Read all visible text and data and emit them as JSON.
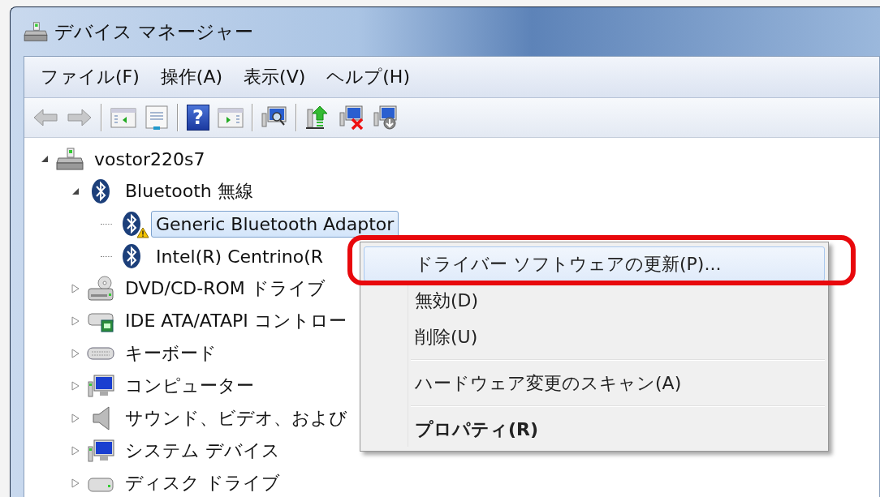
{
  "window": {
    "title": "デバイス マネージャー"
  },
  "menu_bar": [
    "ファイル(F)",
    "操作(A)",
    "表示(V)",
    "ヘルプ(H)"
  ],
  "toolbar": [
    {
      "kind": "back",
      "disabled": true
    },
    {
      "kind": "forward",
      "disabled": true
    },
    {
      "kind": "separator"
    },
    {
      "kind": "tree-pane",
      "disabled": false
    },
    {
      "kind": "properties",
      "disabled": false
    },
    {
      "kind": "separator"
    },
    {
      "kind": "help",
      "disabled": false,
      "glyph": "?"
    },
    {
      "kind": "action-pane",
      "disabled": false
    },
    {
      "kind": "separator"
    },
    {
      "kind": "scan",
      "disabled": false
    },
    {
      "kind": "separator"
    },
    {
      "kind": "update",
      "disabled": false
    },
    {
      "kind": "disable",
      "disabled": false
    },
    {
      "kind": "uninstall",
      "disabled": false
    }
  ],
  "tree": [
    {
      "label": "vostor220s7",
      "kind": "computer",
      "expanded": true,
      "selected": false,
      "children": [
        {
          "label": "Bluetooth 無線",
          "kind": "bluetooth",
          "expanded": true,
          "selected": false,
          "children": [
            {
              "label": "Generic Bluetooth Adaptor",
              "kind": "bluetooth",
              "warning": true,
              "selected": true
            },
            {
              "label": "Intel(R) Centrino(R",
              "kind": "bluetooth",
              "warning": false,
              "selected": false
            }
          ]
        },
        {
          "label": "DVD/CD-ROM ドライブ",
          "kind": "dvd",
          "expanded": false,
          "selected": false
        },
        {
          "label": "IDE ATA/ATAPI コントロー",
          "kind": "ide",
          "expanded": false,
          "selected": false
        },
        {
          "label": "キーボード",
          "kind": "keyboard",
          "expanded": false,
          "selected": false
        },
        {
          "label": "コンピューター",
          "kind": "monitor",
          "expanded": false,
          "selected": false
        },
        {
          "label": "サウンド、ビデオ、および",
          "kind": "sound",
          "expanded": false,
          "selected": false
        },
        {
          "label": "システム デバイス",
          "kind": "monitor",
          "expanded": false,
          "selected": false
        },
        {
          "label": "ディスク ドライブ",
          "kind": "disk",
          "expanded": false,
          "selected": false
        }
      ]
    }
  ],
  "context_menu": [
    {
      "kind": "item",
      "label": "ドライバー ソフトウェアの更新(P)...",
      "selected": true,
      "default": false
    },
    {
      "kind": "item",
      "label": "無効(D)",
      "selected": false,
      "default": false
    },
    {
      "kind": "item",
      "label": "削除(U)",
      "selected": false,
      "default": false
    },
    {
      "kind": "separator"
    },
    {
      "kind": "item",
      "label": "ハードウェア変更のスキャン(A)",
      "selected": false,
      "default": false
    },
    {
      "kind": "separator"
    },
    {
      "kind": "item",
      "label": "プロパティ(R)",
      "selected": false,
      "default": true
    }
  ],
  "annotation": {
    "shown": true
  }
}
